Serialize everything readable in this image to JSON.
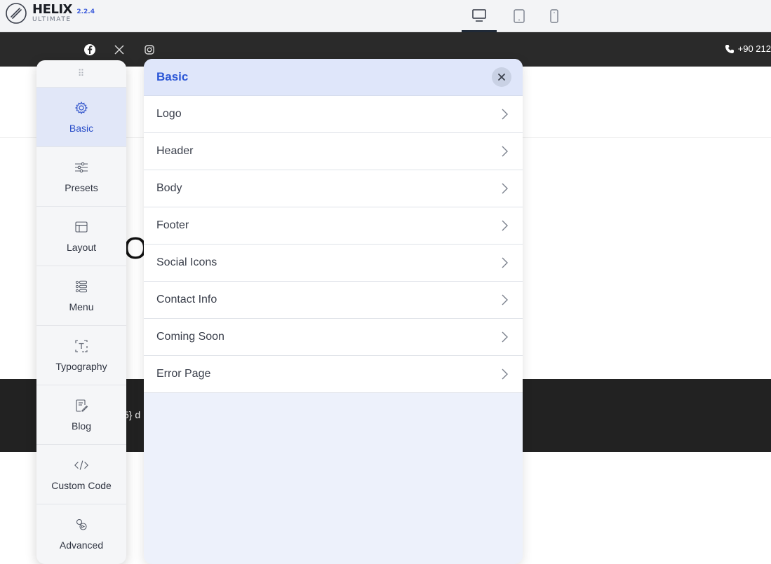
{
  "topbar": {
    "logo_name": "HELIX",
    "logo_version": "2.2.4",
    "logo_sub": "ULTIMATE",
    "devices": [
      "desktop-icon",
      "tablet-icon",
      "mobile-icon"
    ],
    "active_device": "desktop"
  },
  "socialbar": {
    "icons": [
      "facebook-icon",
      "x-icon",
      "instagram-icon"
    ],
    "phone": "+90 212"
  },
  "page": {
    "heading_fragment": "O",
    "footer_fragment": "5} d"
  },
  "sidebar": {
    "items": [
      {
        "label": "Basic",
        "icon": "gear-icon",
        "active": true
      },
      {
        "label": "Presets",
        "icon": "sliders-icon",
        "active": false
      },
      {
        "label": "Layout",
        "icon": "layout-icon",
        "active": false
      },
      {
        "label": "Menu",
        "icon": "menu-icon",
        "active": false
      },
      {
        "label": "Typography",
        "icon": "typography-icon",
        "active": false
      },
      {
        "label": "Blog",
        "icon": "blog-icon",
        "active": false
      },
      {
        "label": "Custom Code",
        "icon": "code-icon",
        "active": false
      },
      {
        "label": "Advanced",
        "icon": "advanced-icon",
        "active": false
      }
    ]
  },
  "panel": {
    "title": "Basic",
    "items": [
      "Logo",
      "Header",
      "Body",
      "Footer",
      "Social Icons",
      "Contact Info",
      "Coming Soon",
      "Error Page"
    ]
  },
  "colors": {
    "accent": "#2b56d6",
    "sidebar_active_bg": "#e1e7f8",
    "panel_bg": "#edf1fb",
    "dark_bar": "#2a2a2a"
  }
}
